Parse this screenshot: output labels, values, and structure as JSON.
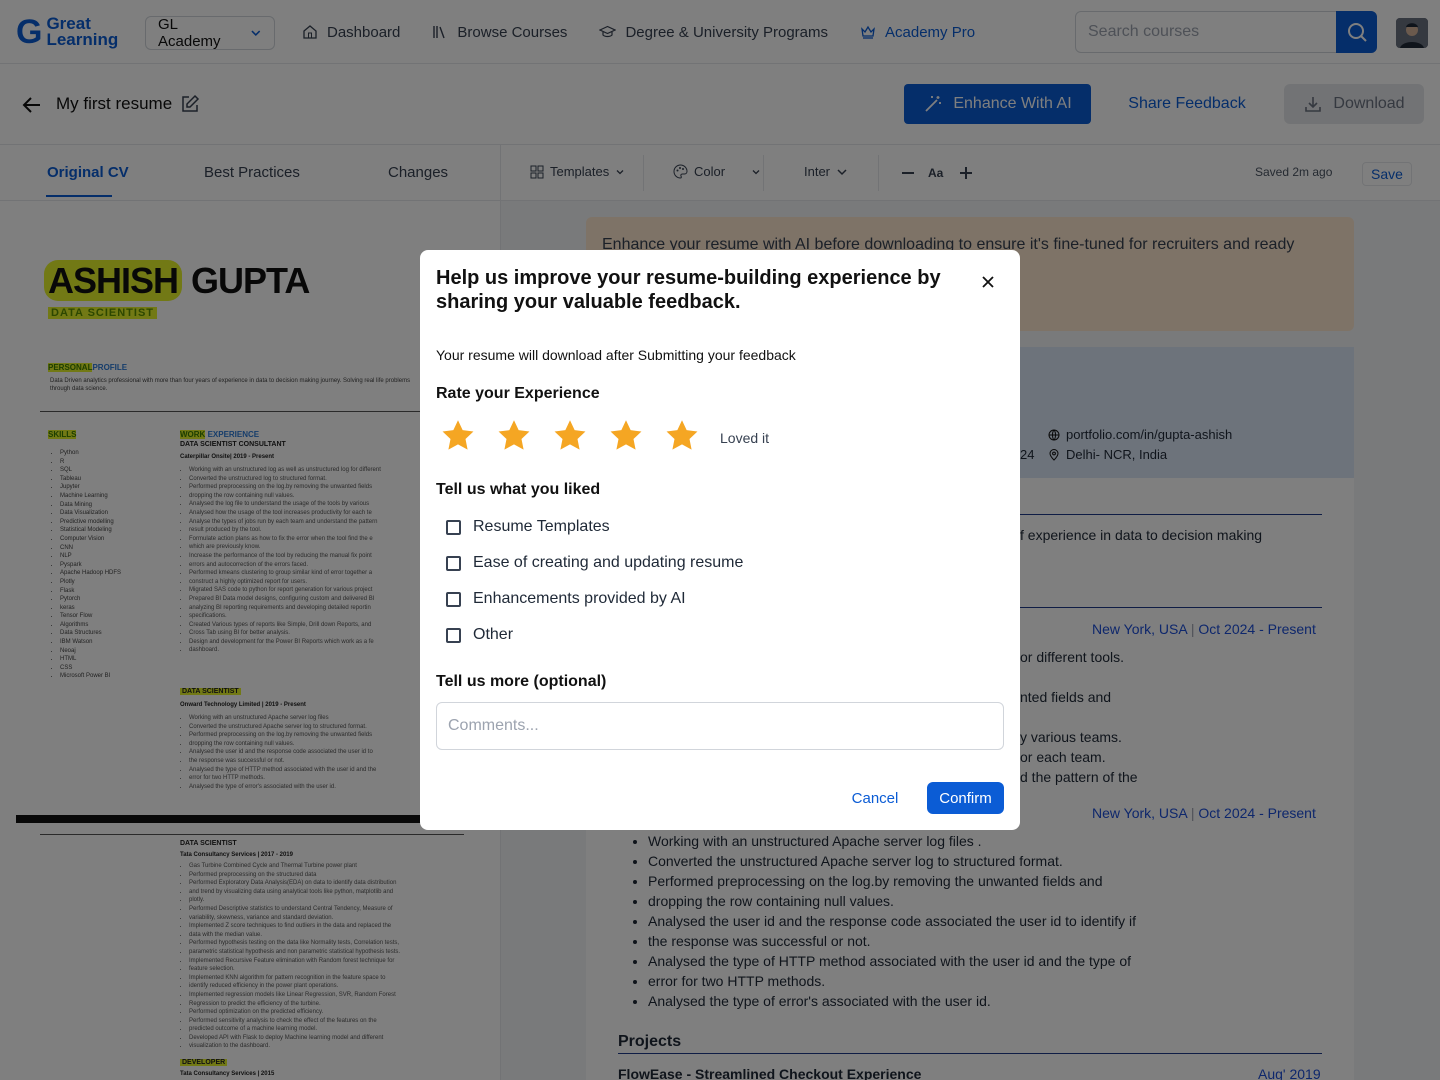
{
  "topnav": {
    "logo_line1": "Great",
    "logo_line2": "Learning",
    "academy_select": "GL Academy",
    "links": [
      {
        "label": "Dashboard",
        "icon": "home-icon"
      },
      {
        "label": "Browse Courses",
        "icon": "library-icon"
      },
      {
        "label": "Degree & University Programs",
        "icon": "graduation-cap-icon"
      },
      {
        "label": "Academy Pro",
        "icon": "crown-icon"
      }
    ],
    "search_placeholder": "Search courses"
  },
  "toolbar": {
    "resume_title": "My first resume",
    "enhance_label": "Enhance With AI",
    "share_label": "Share Feedback",
    "download_label": "Download"
  },
  "tabs": [
    "Original CV",
    "Best Practices",
    "Changes"
  ],
  "editor_tools": {
    "templates": "Templates",
    "color": "Color",
    "font": "Inter",
    "saved_status": "Saved 2m ago",
    "save_label": "Save"
  },
  "original_cv": {
    "first_name": "ASHISH",
    "last_name": "GUPTA",
    "role": "DATA SCIENTIST",
    "profile_heading_a": "PERSONAL",
    "profile_heading_b": "PROFILE",
    "profile_text": "Data Driven analytics professional with more than four years of experience in data to decision making journey. Solving real life problems through data science.",
    "skills_heading": "SKILLS",
    "work_heading_a": "WORK",
    "work_heading_b": "EXPERIENCE",
    "skills": [
      "Python",
      "R",
      "SQL",
      "Tableau",
      "Jupyter",
      "Machine Learning",
      "Data Mining",
      "Data Visualization",
      "Predictive modelling",
      "Statistical Modeling",
      "Computer Vision",
      "CNN",
      "NLP",
      "Pyspark",
      "Apache Hadoop HDFS",
      "Plotly",
      "Flask",
      "Pytorch",
      "keras",
      "Tensor Flow",
      "Algorithms",
      "Data Structures",
      "IBM Watson",
      "Neoaj",
      "HTML",
      "CSS",
      "Microsoft Power BI"
    ],
    "job1_title": "DATA SCIENTIST CONSULTANT",
    "job1_company": "Caterpillar Onsite| 2019 - Present",
    "job1_bullets": [
      "Working with an unstructured log as well as unstructured log for different",
      "Converted the unstructured log to structured format.",
      "Performed preprocessing on the log.by removing the unwanted fields",
      "dropping the row containing null values.",
      "Analysed the log file to understand the usage of the tools by various",
      "Analysed how the usage of the tool increases productivity for each te",
      "Analyse the types of jobs run by each team and understand the pattern",
      "result produced by the tool.",
      "Formulate action plans as how to fix the error when the tool find the e",
      "which are previously know.",
      "Increase the performance of the tool by reducing the manual fix point",
      "errors and autocorrection of the errors faced.",
      "Performed kmeans clustering to group similar kind of error together a",
      "construct a highly optimized report for users.",
      "Migrated SAS code to python for report generation for various project",
      "Prepared BI Data model designs, configuring custom and delivered BI",
      "analyzing BI reporting requirements and developing detailed reportin",
      "specifications.",
      "Created Various types of reports like Simple, Drill down Reports, and",
      "Cross Tab using BI for better analysis.",
      "Design and development for the Power BI Reports which work as a fe",
      "dashboard."
    ],
    "job2_title": "DATA SCIENTIST",
    "job2_company": "Onward Technology Limited | 2019 - Present",
    "job2_bullets": [
      "Working with an unstructured Apache server log files",
      "Converted the unstructured Apache server log to structured format.",
      "Performed preprocessing on the log.by removing the unwanted fields",
      "dropping the row containing null values.",
      "Analysed the user id and the response code associated the user id to",
      "the response was successful or not.",
      "Analysed the type of HTTP method associated with the user id and the",
      "error for two HTTP methods.",
      "Analysed the type of error's associated with the user id."
    ],
    "job3_title": "DATA SCIENTIST",
    "job3_company": "Tata Consultancy Services | 2017 - 2019",
    "job3_bullets": [
      "Gas Turbine Combined Cycle and Thermal Turbine power plant",
      "Performed preprocessing on the structured data",
      "Performed Exploratory Data Analysis(EDA) on data to identify data distribution",
      "and trend by visualizing data using analytical tools like python, matplotlib and",
      "plotly.",
      "Performed Descriptive statistics to understand Central Tendency, Measure of",
      "variability, skewness, variance and standard deviation.",
      "Implemented Z score techniques to find outliers in the data and replaced the",
      "data with the median value.",
      "Performed hypothesis testing on the data like Normality tests, Correlation tests,",
      "parametric statistical hypothesis and non parametric statistical hypothesis tests.",
      "Implemented Recursive Feature elimination with Random forest technique for",
      "feature selection.",
      "Implemented KNN algorithm for pattern recognition in the feature space to",
      "identify reduced efficiency in the power plant operations.",
      "Implemented regression models like Linear Regression, SVR, Random Forest",
      "Regression to predict the efficiency of the turbine.",
      "Performed optimization on the predicted efficiency.",
      "Performed sensitivity analysis to check the effect of the features on the",
      "predicted outcome of a machine learning model.",
      "Developed API with Flask to deploy Machine learning model and different",
      "visualization to the dashboard."
    ],
    "job4_title": "DEVELOPER",
    "job4_company": "Tata Consultancy Services | 2015"
  },
  "editor": {
    "banner": "Enhance your resume with AI before downloading to ensure it's fine-tuned for recruiters and ready",
    "portfolio": "portfolio.com/in/gupta-ashish",
    "partial_24": "24",
    "location": "Delhi- NCR, India",
    "summary_frag": "f experience in data to decision making",
    "job1_location": "New York, USA",
    "job1_dates": "Oct 2024 - Present",
    "frag1": "or different tools.",
    "frag2": "nted fields and",
    "frag3": "y various teams.",
    "frag4": "or each team.",
    "frag5": "d the pattern of the",
    "job2_location": "New York, USA",
    "job2_dates": "Oct 2024 - Present",
    "job2_bullets": [
      "Working with an unstructured Apache server log files .",
      "Converted the unstructured Apache server log to structured format.",
      "Performed preprocessing on the log.by removing the unwanted fields and",
      "dropping the row containing null values.",
      "Analysed the user id and the response code associated the user id to identify if",
      "the response was successful or not.",
      "Analysed the type of HTTP method associated with the user id and the type of",
      "error for two HTTP methods.",
      "Analysed the type of error's associated with the user id."
    ],
    "projects_heading": "Projects",
    "project1": "FlowEase - Streamlined Checkout Experience",
    "project1_date": "Aug' 2019"
  },
  "modal": {
    "title": "Help us improve your resume-building experience by sharing your valuable feedback.",
    "description": "Your resume will download after Submitting your feedback",
    "rate_heading": "Rate your Experience",
    "rating": 5,
    "rating_max": 5,
    "rating_label": "Loved it",
    "liked_heading": "Tell us what you liked",
    "options": [
      "Resume Templates",
      "Ease of creating and updating resume",
      "Enhancements provided by AI",
      "Other"
    ],
    "more_heading": "Tell us more (optional)",
    "comment_placeholder": "Comments...",
    "cancel_label": "Cancel",
    "confirm_label": "Confirm"
  },
  "colors": {
    "primary": "#0b5cd5",
    "star": "#f5a623",
    "banner": "#fde7cf",
    "highlight": "#e4f32b"
  }
}
